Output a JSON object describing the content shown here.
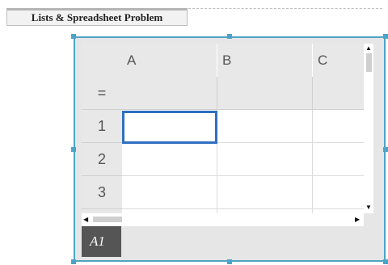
{
  "problem_tab": {
    "title": "Lists & Spreadsheet Problem"
  },
  "sheet": {
    "columns": [
      "A",
      "B",
      "C"
    ],
    "formula_row_label": "=",
    "rows": [
      "1",
      "2",
      "3"
    ],
    "selected_cell": "A1"
  },
  "colors": {
    "frame": "#4fa3c6",
    "selection": "#2f6fc0",
    "header_bg": "#e8e8e8"
  }
}
